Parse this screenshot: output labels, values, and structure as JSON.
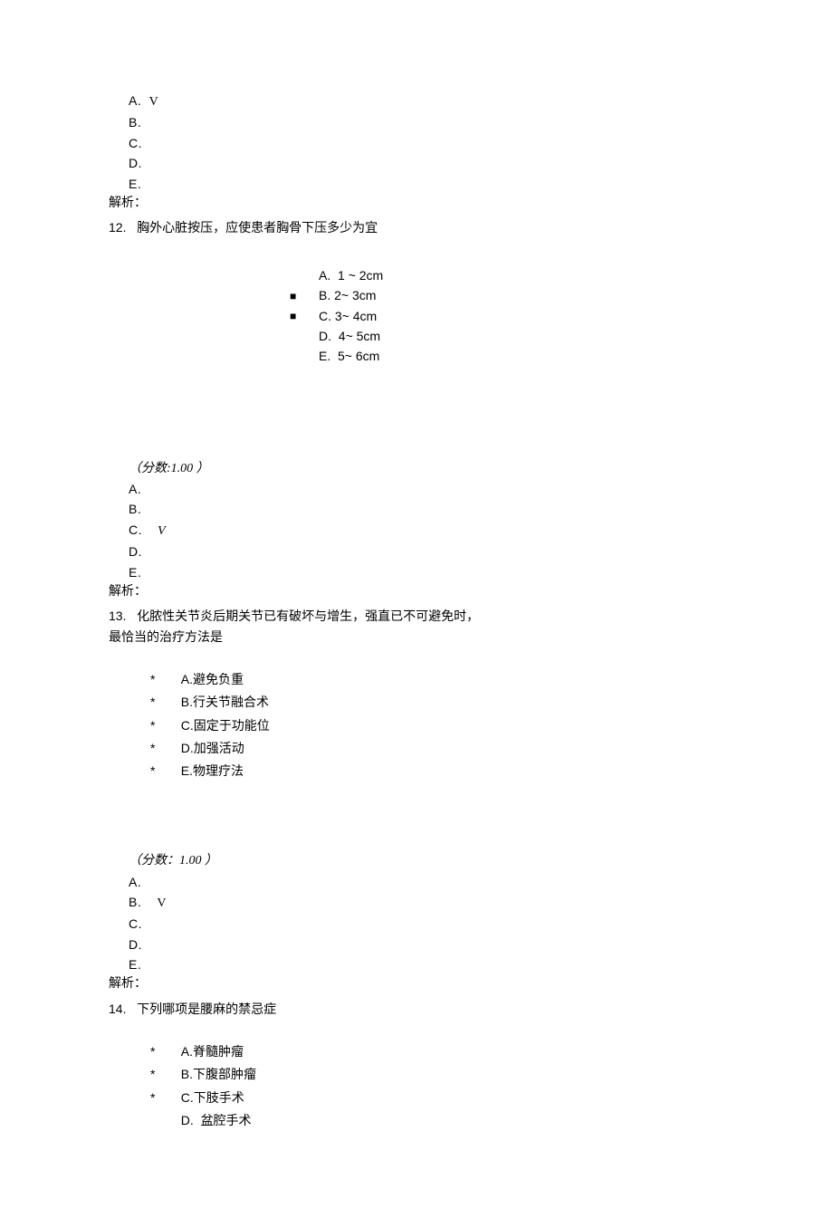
{
  "q11_tail": {
    "answers": [
      {
        "letter": "A.",
        "mark": "V"
      },
      {
        "letter": "B.",
        "mark": ""
      },
      {
        "letter": "C.",
        "mark": ""
      },
      {
        "letter": "D.",
        "mark": ""
      },
      {
        "letter": "E.",
        "mark": ""
      }
    ],
    "analysis_label": "解析："
  },
  "q12": {
    "num": "12.",
    "stem": "胸外心脏按压，应使患者胸骨下压多少为宜",
    "options": [
      {
        "bullet": "",
        "letter": "A.",
        "text": "1 ~ 2cm"
      },
      {
        "bullet": "■",
        "letter": "B.",
        "text": "2~ 3cm"
      },
      {
        "bullet": "■",
        "letter": "C.",
        "text": "3~ 4cm"
      },
      {
        "bullet": "",
        "letter": "D.",
        "text": "4~ 5cm"
      },
      {
        "bullet": "",
        "letter": "E.",
        "text": "5~ 6cm"
      }
    ],
    "score_label": "（分数:1.00 ）",
    "answers": [
      {
        "letter": "A.",
        "mark": ""
      },
      {
        "letter": "B.",
        "mark": ""
      },
      {
        "letter": "C.",
        "mark": "V",
        "italic": true
      },
      {
        "letter": "D.",
        "mark": ""
      },
      {
        "letter": "E.",
        "mark": ""
      }
    ],
    "analysis_label": "解析："
  },
  "q13": {
    "num": "13.",
    "stem_l1": "化脓性关节炎后期关节已有破坏与增生，强直已不可避免时，",
    "stem_l2": "最恰当的治疗方法是",
    "options": [
      {
        "letter": "A.",
        "text": "避免负重"
      },
      {
        "letter": "B.",
        "text": "行关节融合术"
      },
      {
        "letter": "C.",
        "text": "固定于功能位"
      },
      {
        "letter": "D.",
        "text": "加强活动"
      },
      {
        "letter": "E.",
        "text": "物理疗法"
      }
    ],
    "score_label": "（分数：1.00 ）",
    "answers": [
      {
        "letter": "A.",
        "mark": ""
      },
      {
        "letter": "B.",
        "mark": "V"
      },
      {
        "letter": "C.",
        "mark": ""
      },
      {
        "letter": "D.",
        "mark": ""
      },
      {
        "letter": "E.",
        "mark": ""
      }
    ],
    "analysis_label": "解析："
  },
  "q14": {
    "num": "14.",
    "stem": "下列哪项是腰麻的禁忌症",
    "options": [
      {
        "star": "*",
        "letter": "A.",
        "text": "脊髓肿瘤"
      },
      {
        "star": "*",
        "letter": "B.",
        "text": "下腹部肿瘤"
      },
      {
        "star": "*",
        "letter": "C.",
        "text": "下肢手术"
      },
      {
        "star": "",
        "letter": "D.",
        "text": "盆腔手术"
      }
    ]
  }
}
